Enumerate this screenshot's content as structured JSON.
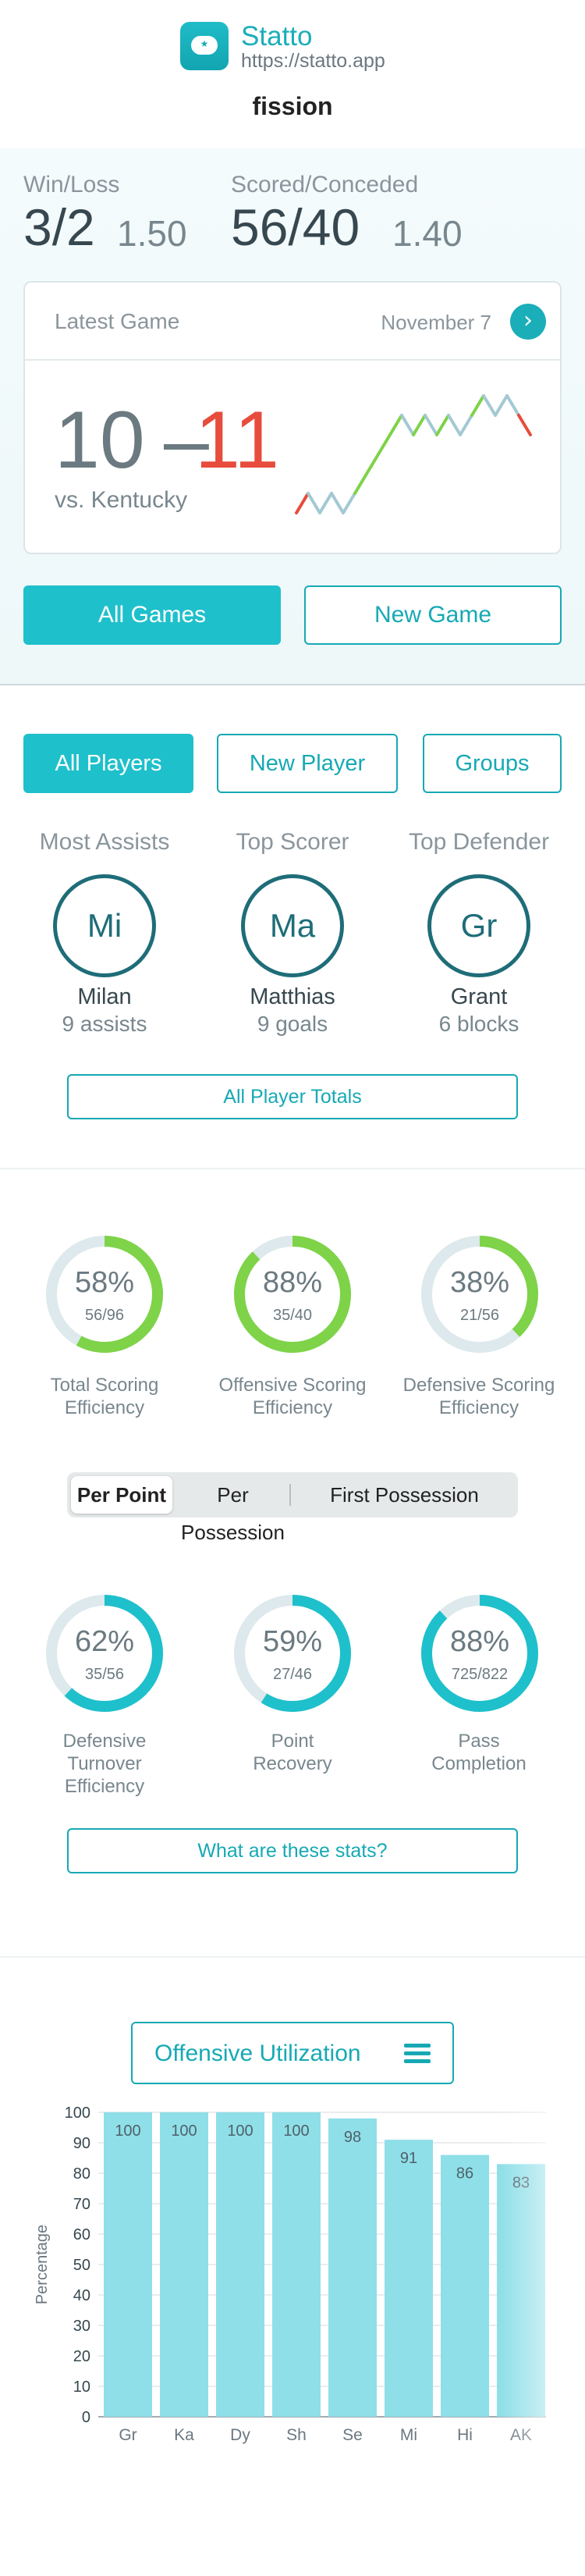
{
  "header": {
    "app_name": "Statto",
    "app_url": "https://statto.app",
    "team_name": "fission",
    "icon": "chat-bubble-star-icon"
  },
  "games": {
    "win_loss_label": "Win/Loss",
    "win_loss_value": "3/2",
    "win_loss_ratio": "1.50",
    "scored_conceded_label": "Scored/Conceded",
    "scored_conceded_value": "56/40",
    "scored_conceded_ratio": "1.40",
    "latest": {
      "title": "Latest Game",
      "date": "November 7",
      "arrow_icon": "chevron-right-icon",
      "score_us": "10",
      "dash": "–",
      "score_them": "11",
      "opponent": "vs. Kentucky",
      "sparkline": [
        0,
        1,
        0,
        1,
        0,
        1,
        2,
        3,
        4,
        5,
        4,
        5,
        4,
        5,
        4,
        5,
        6,
        5,
        6,
        5,
        4
      ],
      "colors": {
        "up": "#7ed348",
        "down": "#e74c3c",
        "flat": "#a3c9d3"
      }
    },
    "all_games_label": "All Games",
    "new_game_label": "New Game"
  },
  "players": {
    "all_players_label": "All Players",
    "new_player_label": "New Player",
    "groups_label": "Groups",
    "leaders": [
      {
        "title": "Most Assists",
        "initials": "Mi",
        "name": "Milan",
        "stat": "9 assists"
      },
      {
        "title": "Top Scorer",
        "initials": "Ma",
        "name": "Matthias",
        "stat": "9 goals"
      },
      {
        "title": "Top Defender",
        "initials": "Gr",
        "name": "Grant",
        "stat": "6 blocks"
      }
    ],
    "totals_label": "All Player Totals"
  },
  "efficiency": {
    "top_rings": [
      {
        "pct": "58%",
        "frac": "56/96",
        "value": 0.58,
        "color": "#7ed348",
        "label1": "Total Scoring",
        "label2": "Efficiency"
      },
      {
        "pct": "88%",
        "frac": "35/40",
        "value": 0.88,
        "color": "#7ed348",
        "label1": "Offensive Scoring",
        "label2": "Efficiency"
      },
      {
        "pct": "38%",
        "frac": "21/56",
        "value": 0.38,
        "color": "#7ed348",
        "label1": "Defensive Scoring",
        "label2": "Efficiency"
      }
    ],
    "segments": [
      "Per Point",
      "Per Possession",
      "First Possession"
    ],
    "bottom_rings": [
      {
        "pct": "62%",
        "frac": "35/56",
        "value": 0.62,
        "color": "#1ec0cb",
        "label1": "Defensive",
        "label2": "Turnover",
        "label3": "Efficiency"
      },
      {
        "pct": "59%",
        "frac": "27/46",
        "value": 0.59,
        "color": "#1ec0cb",
        "label1": "Point",
        "label2": "Recovery",
        "label3": ""
      },
      {
        "pct": "88%",
        "frac": "725/822",
        "value": 0.88,
        "color": "#1ec0cb",
        "label1": "Pass",
        "label2": "Completion",
        "label3": ""
      }
    ],
    "ring_track_color": "#dde9ec",
    "help_label": "What are these stats?"
  },
  "utilization": {
    "button_label": "Offensive Utilization",
    "menu_icon": "hamburger-menu-icon",
    "chart_data": {
      "type": "bar",
      "categories": [
        "Gr",
        "Ka",
        "Dy",
        "Sh",
        "Se",
        "Mi",
        "Hi",
        "AK"
      ],
      "values": [
        100,
        100,
        100,
        100,
        98,
        91,
        86,
        83
      ],
      "ylabel": "Percentage",
      "xlabel": "",
      "ylim": [
        0,
        100
      ],
      "yticks": [
        0,
        10,
        20,
        30,
        40,
        50,
        60,
        70,
        80,
        90,
        100
      ],
      "bar_color": "#8fdfe8",
      "grid": true
    }
  }
}
